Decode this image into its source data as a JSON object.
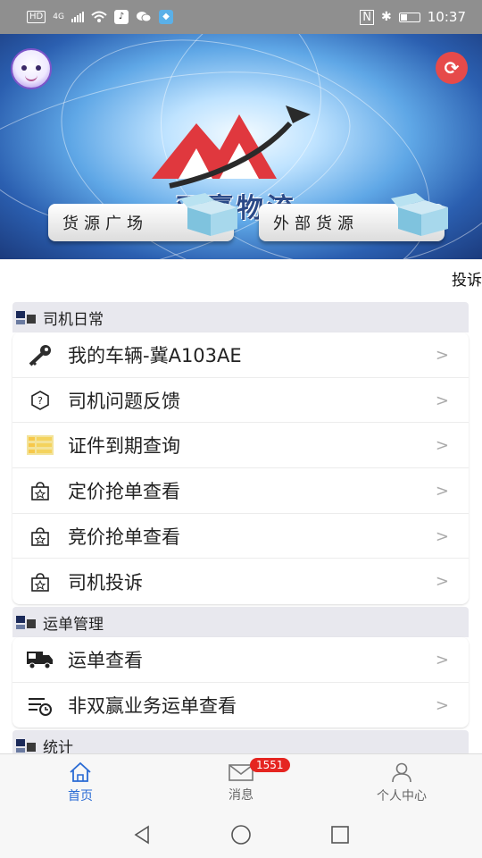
{
  "status_bar": {
    "hd_label": "HD",
    "net_label": "4G",
    "time": "10:37",
    "icons": [
      "wifi-icon",
      "tiktok-icon",
      "wechat-icon",
      "app-icon",
      "nfc-icon",
      "bluetooth-icon",
      "battery-icon"
    ]
  },
  "banner": {
    "logo_text": "双赢物流",
    "btn_goods_square": "货源广场",
    "btn_external_goods": "外部货源",
    "colors": {
      "sky": "#5fa7e6",
      "logo_red": "#e0383e",
      "logo_dark": "#2b4a88"
    }
  },
  "complaint_strip": {
    "text": "投诉"
  },
  "sections": {
    "driver_daily": {
      "title": "司机日常",
      "items": [
        {
          "label": "我的车辆-冀A103AE",
          "icon": "key-icon"
        },
        {
          "label": "司机问题反馈",
          "icon": "question-icon"
        },
        {
          "label": "证件到期查询",
          "icon": "list-icon"
        },
        {
          "label": "定价抢单查看",
          "icon": "star-bag-icon"
        },
        {
          "label": "竞价抢单查看",
          "icon": "star-bag-icon"
        },
        {
          "label": "司机投诉",
          "icon": "star-bag-icon"
        }
      ]
    },
    "waybill": {
      "title": "运单管理",
      "items": [
        {
          "label": "运单查看",
          "icon": "truck-icon"
        },
        {
          "label": "非双赢业务运单查看",
          "icon": "list-clock-icon"
        }
      ]
    },
    "stats": {
      "title": "统计"
    }
  },
  "chevron": ">",
  "bottom_nav": {
    "home": "首页",
    "messages": "消息",
    "messages_badge": "1551",
    "profile": "个人中心",
    "active_color": "#2a6bd4"
  }
}
